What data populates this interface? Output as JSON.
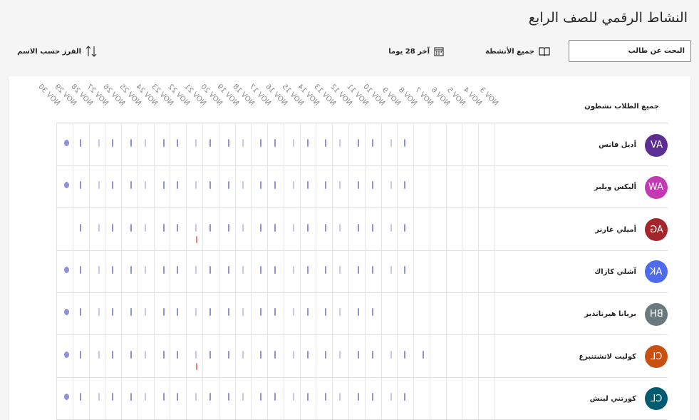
{
  "page": {
    "title": "النشاط الرقمي للصف الرابع"
  },
  "toolbar": {
    "search_placeholder": "البحث عن طالب",
    "activities_label": "جميع الأنشطة",
    "period_label": "آخر 28 يوما",
    "sort_label": "الفرز حسب الاسم",
    "icons": {
      "activities": "book-icon",
      "period": "calendar-icon",
      "sort": "sort-arrows-icon"
    }
  },
  "grid": {
    "header_label": "جميع الطلاب نشطون",
    "dates": [
      "NOV 3",
      "NOV 4",
      "NOV 5",
      "NOV 6",
      "NOV 7",
      "NOV 8",
      "NOV 9",
      "NOV 10",
      "NOV 11",
      "NOV 12",
      "NOV 13",
      "NOV 14",
      "NOV 15",
      "NOV 16",
      "NOV 17",
      "NOV 18",
      "NOV 19",
      "NOV 20",
      "NOV 21",
      "NOV 22",
      "NOV 23",
      "NOV 24",
      "NOV 25",
      "NOV 26",
      "NOV 27",
      "NOV 28",
      "NOV 29",
      "NOV 30"
    ],
    "students": [
      {
        "initials": "AV",
        "name": "أديل فانس",
        "avatar_color": "#5c2e91",
        "activity": [
          0,
          0,
          0,
          0,
          0,
          0,
          1,
          1,
          1,
          1,
          1,
          1,
          1,
          1,
          1,
          1,
          1,
          1,
          1,
          1,
          1,
          1,
          1,
          1,
          1,
          1,
          1,
          0
        ],
        "today": true,
        "alerts": []
      },
      {
        "initials": "AW",
        "name": "أليكس ويلبر",
        "avatar_color": "#c239b3",
        "activity": [
          0,
          0,
          0,
          0,
          0,
          0,
          1,
          1,
          1,
          1,
          1,
          1,
          1,
          1,
          1,
          1,
          1,
          1,
          1,
          1,
          1,
          1,
          1,
          1,
          1,
          1,
          1,
          0
        ],
        "today": true,
        "alerts": []
      },
      {
        "initials": "AG",
        "name": "أميلي غارنر",
        "avatar_color": "#a4262c",
        "activity": [
          0,
          0,
          0,
          0,
          0,
          0,
          1,
          1,
          1,
          1,
          1,
          1,
          1,
          1,
          1,
          1,
          1,
          1,
          1,
          1,
          1,
          1,
          1,
          1,
          1,
          1,
          1,
          0
        ],
        "today": false,
        "alerts": [
          "NOV 22"
        ]
      },
      {
        "initials": "AK",
        "name": "آشلي كازاك",
        "avatar_color": "#4f6bed",
        "activity": [
          0,
          0,
          0,
          0,
          0,
          0,
          1,
          1,
          1,
          1,
          1,
          1,
          1,
          1,
          1,
          1,
          1,
          1,
          1,
          1,
          1,
          1,
          1,
          1,
          1,
          1,
          1,
          0
        ],
        "today": true,
        "alerts": []
      },
      {
        "initials": "BH",
        "name": "بريانا هيرنانديز",
        "avatar_color": "#69797e",
        "activity": [
          0,
          0,
          0,
          0,
          0,
          0,
          0,
          0,
          1,
          1,
          1,
          1,
          1,
          1,
          1,
          1,
          1,
          1,
          1,
          1,
          1,
          1,
          1,
          1,
          1,
          1,
          1,
          0
        ],
        "today": true,
        "alerts": []
      },
      {
        "initials": "CL",
        "name": "كوليت لاتشتنبرغ",
        "avatar_color": "#ca5010",
        "activity": [
          0,
          0,
          0,
          0,
          0,
          1,
          1,
          1,
          1,
          1,
          1,
          1,
          1,
          1,
          1,
          1,
          1,
          1,
          1,
          1,
          1,
          1,
          1,
          1,
          1,
          1,
          1,
          0
        ],
        "today": true,
        "alerts": [
          "NOV 22"
        ]
      },
      {
        "initials": "CL",
        "name": "كورتني لينش",
        "avatar_color": "#005b70",
        "activity": [
          0,
          0,
          0,
          0,
          0,
          0,
          1,
          1,
          1,
          1,
          1,
          1,
          1,
          1,
          1,
          1,
          1,
          1,
          1,
          1,
          1,
          1,
          1,
          1,
          1,
          1,
          1,
          0
        ],
        "today": true,
        "alerts": []
      }
    ]
  },
  "colors": {
    "tick": "#8f92d6",
    "tick_light": "#c7c9ec",
    "alert": "#e8827d"
  }
}
